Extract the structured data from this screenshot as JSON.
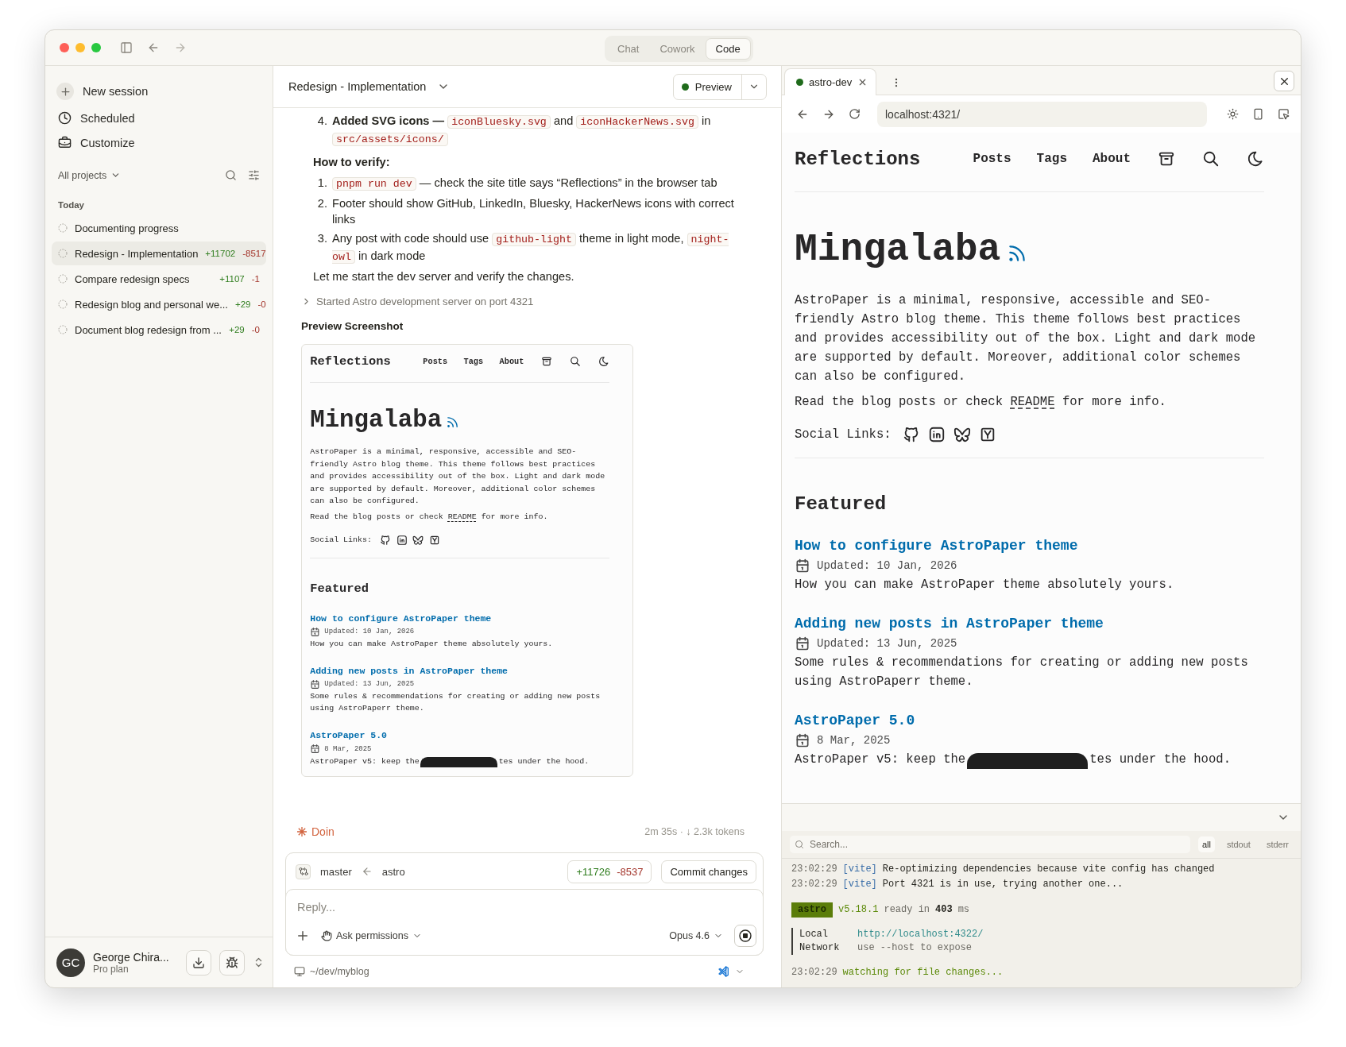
{
  "window": {
    "tabs": [
      {
        "label": "Chat",
        "selected": false
      },
      {
        "label": "Cowork",
        "selected": false
      },
      {
        "label": "Code",
        "selected": true
      }
    ]
  },
  "sidebar": {
    "actions": [
      {
        "label": "New session"
      },
      {
        "label": "Scheduled"
      },
      {
        "label": "Customize"
      }
    ],
    "filter": "All projects",
    "group": "Today",
    "sessions": [
      {
        "title": "Documenting progress",
        "selected": false
      },
      {
        "title": "Redesign - Implementation",
        "added": "+11702",
        "removed": "-8517",
        "selected": true
      },
      {
        "title": "Compare redesign specs",
        "added": "+1107",
        "removed": "-1",
        "selected": false
      },
      {
        "title": "Redesign blog and personal we...",
        "added": "+29",
        "removed": "-0",
        "selected": false
      },
      {
        "title": "Document blog redesign from ...",
        "added": "+29",
        "removed": "-0",
        "selected": false
      }
    ],
    "user": {
      "initials": "GC",
      "name": "George Chira...",
      "plan": "Pro plan"
    }
  },
  "chat": {
    "title": "Redesign - Implementation",
    "preview_button": "Preview",
    "cut_item": {
      "number": "4.",
      "segments": [
        {
          "kind": "bold",
          "text": "Added SVG icons —"
        },
        {
          "kind": "code",
          "text": "iconBluesky.svg"
        },
        {
          "kind": "text",
          "text": "and"
        },
        {
          "kind": "code",
          "text": "iconHackerNews.svg"
        },
        {
          "kind": "text",
          "text": "in"
        },
        {
          "kind": "code",
          "text": "src/assets/icons/"
        }
      ]
    },
    "heading": "How to verify:",
    "steps": [
      {
        "number": "1.",
        "segments": [
          {
            "kind": "code",
            "text": "pnpm run dev"
          },
          {
            "kind": "text",
            "text": "— check the site title says “Reflections” in the browser tab"
          }
        ]
      },
      {
        "number": "2.",
        "segments": [
          {
            "kind": "text",
            "text": "Footer should show GitHub, LinkedIn, Bluesky, HackerNews icons with correct links"
          }
        ]
      },
      {
        "number": "3.",
        "segments": [
          {
            "kind": "text",
            "text": "Any post with code should use"
          },
          {
            "kind": "code",
            "text": "github-light"
          },
          {
            "kind": "text",
            "text": "theme in light mode,"
          },
          {
            "kind": "code",
            "text": "night-owl"
          },
          {
            "kind": "text",
            "text": "in dark mode"
          }
        ]
      }
    ],
    "closing": "Let me start the dev server and verify the changes.",
    "tool_step": {
      "label": "Started Astro development server on port 4321",
      "expanded": false
    },
    "screenshot_heading": "Preview Screenshot",
    "status": "Doin",
    "meta": "2m 35s · ↓ 2.3k tokens",
    "branch": {
      "base": "master",
      "head": "astro",
      "added": "+11726",
      "removed": "-8537",
      "commit": "Commit changes"
    },
    "reply_placeholder": "Reply...",
    "permissions": "Ask permissions",
    "model": "Opus 4.6",
    "path": "~/dev/myblog"
  },
  "preview_screenshot": {
    "site_title": "Reflections",
    "nav": [
      "Posts",
      "Tags",
      "About"
    ],
    "hero": "Mingalaba",
    "intro": "AstroPaper is a minimal, responsive, accessible and SEO-friendly Astro blog theme. This theme follows best practices and provides accessibility out of the box. Light and dark mode are supported by default. Moreover, additional color schemes can also be configured.",
    "readme": {
      "before": "Read the blog posts or check",
      "link": "README",
      "after": "for more info."
    },
    "social_label": "Social Links:",
    "featured": "Featured",
    "posts": [
      {
        "title": "How to configure AstroPaper theme",
        "date": "Updated: 10 Jan, 2026",
        "description": "How you can make AstroPaper theme absolutely yours."
      },
      {
        "title": "Adding new posts in AstroPaper theme",
        "date": "Updated: 13 Jun, 2025",
        "description": "Some rules & recommendations for creating or adding new posts using AstroPaperr theme."
      },
      {
        "title": "AstroPaper 5.0",
        "date": "8 Mar, 2025",
        "description": "AstroPaper v5: keep the",
        "description_after_overlay": "tes under the hood."
      }
    ]
  },
  "browser": {
    "tab": "astro-dev",
    "url": "localhost:4321/",
    "page": {
      "site_title": "Reflections",
      "nav": [
        "Posts",
        "Tags",
        "About"
      ],
      "hero": "Mingalaba",
      "intro": "AstroPaper is a minimal, responsive, accessible and SEO-friendly Astro blog theme. This theme follows best practices and provides accessibility out of the box. Light and dark mode are supported by default. Moreover, additional color schemes can also be configured.",
      "readme": {
        "before": "Read the blog posts or check",
        "link": "README",
        "after": "for more info."
      },
      "social_label": "Social Links:",
      "featured": "Featured",
      "posts": [
        {
          "title": "How to configure AstroPaper theme",
          "date": "Updated: 10 Jan, 2026",
          "description": "How you can make AstroPaper theme absolutely yours."
        },
        {
          "title": "Adding new posts in AstroPaper theme",
          "date": "Updated: 13 Jun, 2025",
          "description": "Some rules & recommendations for creating or adding new posts using AstroPaperr theme."
        },
        {
          "title": "AstroPaper 5.0",
          "date": "8 Mar, 2025",
          "description": "AstroPaper v5: keep the",
          "description_after_overlay": "tes under the hood."
        }
      ]
    },
    "terminal": {
      "search_placeholder": "Search...",
      "filters": [
        {
          "label": "all",
          "selected": true
        },
        {
          "label": "stdout",
          "selected": false
        },
        {
          "label": "stderr",
          "selected": false
        }
      ],
      "lines": [
        {
          "kind": "log",
          "time": "23:02:29",
          "tag": "[vite]",
          "text": "Re-optimizing dependencies because vite config has changed"
        },
        {
          "kind": "log",
          "time": "23:02:29",
          "tag": "[vite]",
          "text": "Port 4321 is in use, trying another one..."
        },
        {
          "kind": "ready",
          "badge": "astro",
          "version": "v5.18.1",
          "text": "ready in",
          "value": "403",
          "unit": "ms"
        },
        {
          "kind": "address",
          "label": "Local",
          "value": "http://localhost:4322/",
          "link": true
        },
        {
          "kind": "address",
          "label": "Network",
          "value": "use --host to expose",
          "link": false
        },
        {
          "kind": "watch",
          "time": "23:02:29",
          "text": "watching for file changes..."
        }
      ]
    }
  }
}
